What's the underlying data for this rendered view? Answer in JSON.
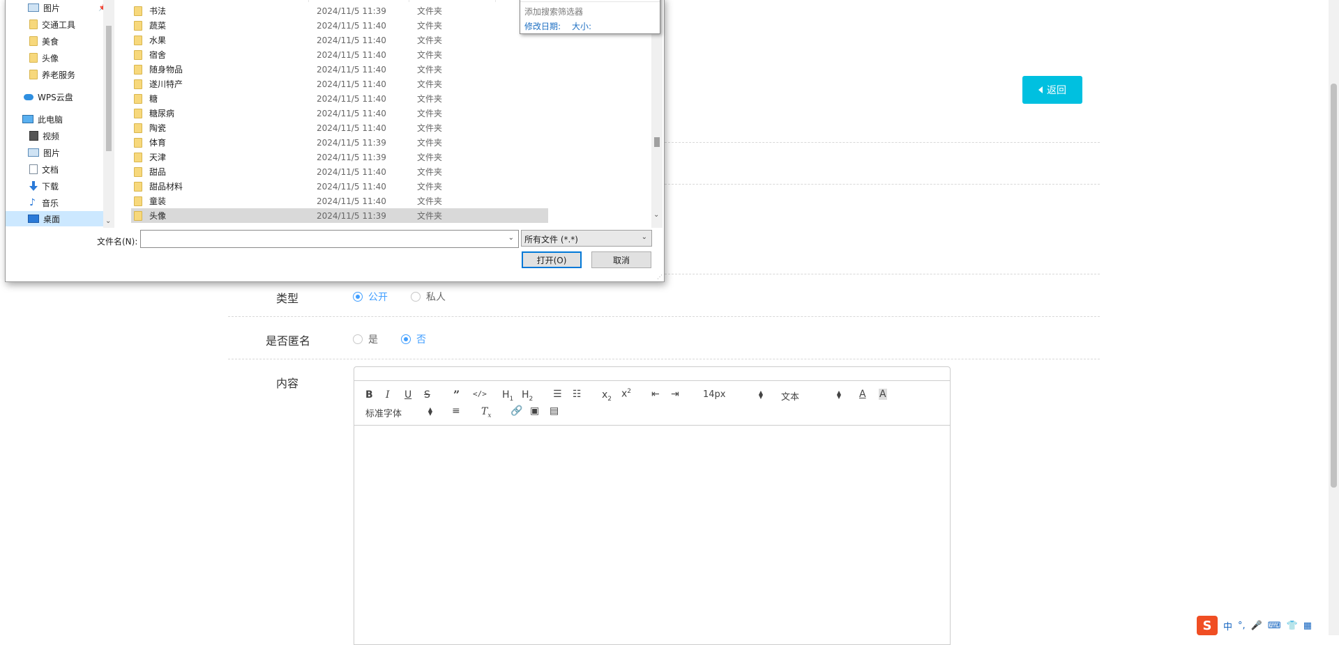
{
  "page": {
    "back_label": "返回",
    "rows": {
      "type_label": "类型",
      "type_options": [
        "公开",
        "私人"
      ],
      "anon_label": "是否匿名",
      "anon_options": [
        "是",
        "否"
      ],
      "content_label": "内容"
    },
    "editor": {
      "font_size": "14px",
      "heading_select": "文本",
      "font_family": "标准字体"
    }
  },
  "dialog": {
    "nav": [
      {
        "label": "图片",
        "icon": "picture-icon",
        "pinned": true
      },
      {
        "label": "交通工具",
        "icon": "folder-icon"
      },
      {
        "label": "美食",
        "icon": "folder-icon"
      },
      {
        "label": "头像",
        "icon": "folder-icon"
      },
      {
        "label": "养老服务",
        "icon": "folder-icon"
      },
      {
        "label": "WPS云盘",
        "icon": "cloud-icon"
      },
      {
        "label": "此电脑",
        "icon": "computer-icon"
      },
      {
        "label": "视频",
        "icon": "video-icon"
      },
      {
        "label": "图片",
        "icon": "picture-icon"
      },
      {
        "label": "文档",
        "icon": "document-icon"
      },
      {
        "label": "下载",
        "icon": "download-icon"
      },
      {
        "label": "音乐",
        "icon": "music-icon"
      },
      {
        "label": "桌面",
        "icon": "desktop-icon",
        "selected": true
      }
    ],
    "files": [
      {
        "name": "书法",
        "date": "2024/11/5 11:39",
        "type": "文件夹"
      },
      {
        "name": "蔬菜",
        "date": "2024/11/5 11:40",
        "type": "文件夹"
      },
      {
        "name": "水果",
        "date": "2024/11/5 11:40",
        "type": "文件夹"
      },
      {
        "name": "宿舍",
        "date": "2024/11/5 11:40",
        "type": "文件夹"
      },
      {
        "name": "随身物品",
        "date": "2024/11/5 11:40",
        "type": "文件夹"
      },
      {
        "name": "遂川特产",
        "date": "2024/11/5 11:40",
        "type": "文件夹"
      },
      {
        "name": "糖",
        "date": "2024/11/5 11:40",
        "type": "文件夹"
      },
      {
        "name": "糖尿病",
        "date": "2024/11/5 11:40",
        "type": "文件夹"
      },
      {
        "name": "陶瓷",
        "date": "2024/11/5 11:40",
        "type": "文件夹"
      },
      {
        "name": "体育",
        "date": "2024/11/5 11:39",
        "type": "文件夹"
      },
      {
        "name": "天津",
        "date": "2024/11/5 11:39",
        "type": "文件夹"
      },
      {
        "name": "甜品",
        "date": "2024/11/5 11:40",
        "type": "文件夹"
      },
      {
        "name": "甜品材料",
        "date": "2024/11/5 11:40",
        "type": "文件夹"
      },
      {
        "name": "童装",
        "date": "2024/11/5 11:40",
        "type": "文件夹"
      },
      {
        "name": "头像",
        "date": "2024/11/5 11:39",
        "type": "文件夹",
        "selected": true
      }
    ],
    "search_filter": {
      "hint": "添加搜索筛选器",
      "opt_modified": "修改日期:",
      "opt_size": "大小:"
    },
    "filename_label": "文件名(N):",
    "filename_value": "",
    "filetype": "所有文件 (*.*)",
    "open_label": "打开(O)",
    "cancel_label": "取消"
  },
  "ime": {
    "mode": "中",
    "punct": "°,"
  },
  "colors": {
    "accent": "#00c0e0",
    "radio_selected": "#409eff",
    "selection": "#cce8ff"
  }
}
